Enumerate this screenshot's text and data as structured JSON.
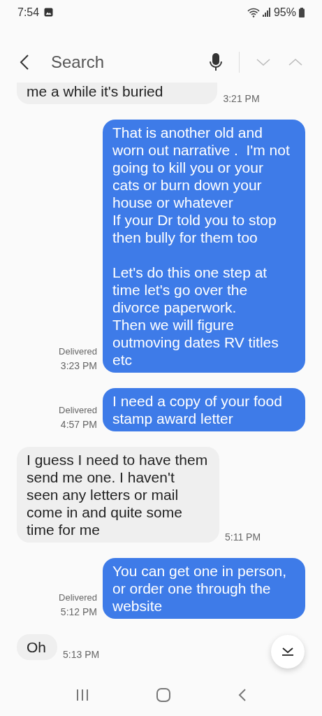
{
  "status_bar": {
    "time": "7:54",
    "battery": "95%"
  },
  "search_bar": {
    "placeholder": "Search"
  },
  "messages": [
    {
      "kind": "received",
      "text": "me a while it's buried",
      "time": "3:21 PM"
    },
    {
      "kind": "sent",
      "text": "That is another old and worn out narrative .  I'm not going to kill you or your cats or burn down your house or whatever\nIf your Dr told you to stop then bully for them too\n\nLet's do this one step at time let's go over the divorce paperwork.\nThen we will figure outmoving dates RV titles etc",
      "status": "Delivered",
      "time": "3:23 PM"
    },
    {
      "kind": "sent",
      "text": "I need a copy of your food stamp award letter",
      "status": "Delivered",
      "time": "4:57 PM"
    },
    {
      "kind": "received",
      "text": "I guess I need to have them send me one. I haven't seen any letters or mail come in and quite some time for me",
      "time": "5:11 PM"
    },
    {
      "kind": "sent",
      "text": "You can get one in person, or order one through the website",
      "status": "Delivered",
      "time": "5:12 PM"
    },
    {
      "kind": "received",
      "text": "Oh",
      "time": "5:13 PM"
    }
  ]
}
